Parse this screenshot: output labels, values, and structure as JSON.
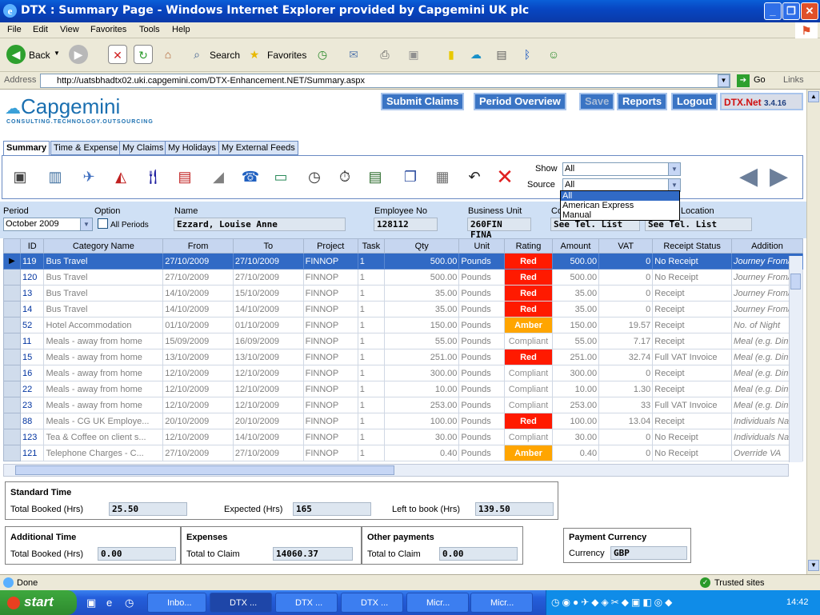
{
  "window": {
    "title": "DTX : Summary Page - Windows Internet Explorer provided by Capgemini UK plc"
  },
  "menu": [
    "File",
    "Edit",
    "View",
    "Favorites",
    "Tools",
    "Help"
  ],
  "toolbar": {
    "back": "Back",
    "search": "Search",
    "favorites": "Favorites"
  },
  "address": {
    "label": "Address",
    "url": "http://uatsbhadtx02.uki.capgemini.com/DTX-Enhancement.NET/Summary.aspx",
    "go": "Go",
    "links": "Links"
  },
  "brand": {
    "name": "Capgemini",
    "tagline": "CONSULTING.TECHNOLOGY.OUTSOURCING"
  },
  "nav": {
    "submit": "Submit Claims",
    "period": "Period Overview",
    "save": "Save",
    "reports": "Reports",
    "logout": "Logout",
    "app": "DTX.Net",
    "version": "3.4.16"
  },
  "tabs": [
    "Summary",
    "Time & Expense",
    "My Claims",
    "My Holidays",
    "My External Feeds"
  ],
  "filters": {
    "show_label": "Show",
    "show_value": "All",
    "source_label": "Source",
    "source_value": "All",
    "source_options": [
      "All",
      "American Express",
      "Manual"
    ]
  },
  "info": {
    "period_label": "Period",
    "period_value": "October 2009",
    "option_label": "Option",
    "all_periods": "All Periods",
    "name_label": "Name",
    "name_value": "Ezzard, Louise Anne",
    "emp_label": "Employee No",
    "emp_value": "128112",
    "bu_label": "Business Unit",
    "bu_value": "260FIN FINA",
    "co_label": "Co",
    "co_value": "See Tel. List",
    "loc_label": "Location",
    "loc_value": "See Tel. List"
  },
  "grid": {
    "columns": [
      "ID",
      "Category Name",
      "From",
      "To",
      "Project",
      "Task",
      "Qty",
      "Unit",
      "Rating",
      "Amount",
      "VAT",
      "Receipt Status",
      "Addition"
    ],
    "rows": [
      [
        "119",
        "Bus Travel",
        "27/10/2009",
        "27/10/2009",
        "FINNOP",
        "1",
        "500.00",
        "Pounds",
        "Red",
        "500.00",
        "0",
        "No Receipt",
        "Journey From/"
      ],
      [
        "120",
        "Bus Travel",
        "27/10/2009",
        "27/10/2009",
        "FINNOP",
        "1",
        "500.00",
        "Pounds",
        "Red",
        "500.00",
        "0",
        "No Receipt",
        "Journey From/"
      ],
      [
        "13",
        "Bus Travel",
        "14/10/2009",
        "15/10/2009",
        "FINNOP",
        "1",
        "35.00",
        "Pounds",
        "Red",
        "35.00",
        "0",
        "Receipt",
        "Journey From/"
      ],
      [
        "14",
        "Bus Travel",
        "14/10/2009",
        "14/10/2009",
        "FINNOP",
        "1",
        "35.00",
        "Pounds",
        "Red",
        "35.00",
        "0",
        "Receipt",
        "Journey From/"
      ],
      [
        "52",
        "Hotel Accommodation",
        "01/10/2009",
        "01/10/2009",
        "FINNOP",
        "1",
        "150.00",
        "Pounds",
        "Amber",
        "150.00",
        "19.57",
        "Receipt",
        "No. of Night"
      ],
      [
        "11",
        "Meals - away from home",
        "15/09/2009",
        "16/09/2009",
        "FINNOP",
        "1",
        "55.00",
        "Pounds",
        "Compliant",
        "55.00",
        "7.17",
        "Receipt",
        "Meal (e.g. Din"
      ],
      [
        "15",
        "Meals - away from home",
        "13/10/2009",
        "13/10/2009",
        "FINNOP",
        "1",
        "251.00",
        "Pounds",
        "Red",
        "251.00",
        "32.74",
        "Full VAT Invoice",
        "Meal (e.g. Din"
      ],
      [
        "16",
        "Meals - away from home",
        "12/10/2009",
        "12/10/2009",
        "FINNOP",
        "1",
        "300.00",
        "Pounds",
        "Compliant",
        "300.00",
        "0",
        "Receipt",
        "Meal (e.g. Din"
      ],
      [
        "22",
        "Meals - away from home",
        "12/10/2009",
        "12/10/2009",
        "FINNOP",
        "1",
        "10.00",
        "Pounds",
        "Compliant",
        "10.00",
        "1.30",
        "Receipt",
        "Meal (e.g. Din"
      ],
      [
        "23",
        "Meals - away from home",
        "12/10/2009",
        "12/10/2009",
        "FINNOP",
        "1",
        "253.00",
        "Pounds",
        "Compliant",
        "253.00",
        "33",
        "Full VAT Invoice",
        "Meal (e.g. Din"
      ],
      [
        "88",
        "Meals - CG UK Employe...",
        "20/10/2009",
        "20/10/2009",
        "FINNOP",
        "1",
        "100.00",
        "Pounds",
        "Red",
        "100.00",
        "13.04",
        "Receipt",
        "Individuals Na"
      ],
      [
        "123",
        "Tea & Coffee on client s...",
        "12/10/2009",
        "14/10/2009",
        "FINNOP",
        "1",
        "30.00",
        "Pounds",
        "Compliant",
        "30.00",
        "0",
        "No Receipt",
        "Individuals Na"
      ],
      [
        "121",
        "Telephone Charges - C...",
        "27/10/2009",
        "27/10/2009",
        "FINNOP",
        "1",
        "0.40",
        "Pounds",
        "Amber",
        "0.40",
        "0",
        "No Receipt",
        "Override VA"
      ]
    ]
  },
  "standard": {
    "title": "Standard Time",
    "booked_label": "Total Booked (Hrs)",
    "booked": "25.50",
    "expected_label": "Expected (Hrs)",
    "expected": "165",
    "left_label": "Left to book (Hrs)",
    "left": "139.50"
  },
  "additional": {
    "title": "Additional Time",
    "booked_label": "Total Booked (Hrs)",
    "booked": "0.00"
  },
  "expenses": {
    "title": "Expenses",
    "claim_label": "Total to Claim",
    "claim": "14060.37"
  },
  "other": {
    "title": "Other payments",
    "claim_label": "Total to Claim",
    "claim": "0.00"
  },
  "currency": {
    "title": "Payment Currency",
    "label": "Currency",
    "value": "GBP"
  },
  "status": {
    "done": "Done",
    "zone": "Trusted sites"
  },
  "taskbar": {
    "start": "start",
    "items": [
      "Inbo...",
      "DTX ...",
      "DTX ...",
      "DTX ...",
      "Micr...",
      "Micr..."
    ],
    "clock": "14:42"
  }
}
